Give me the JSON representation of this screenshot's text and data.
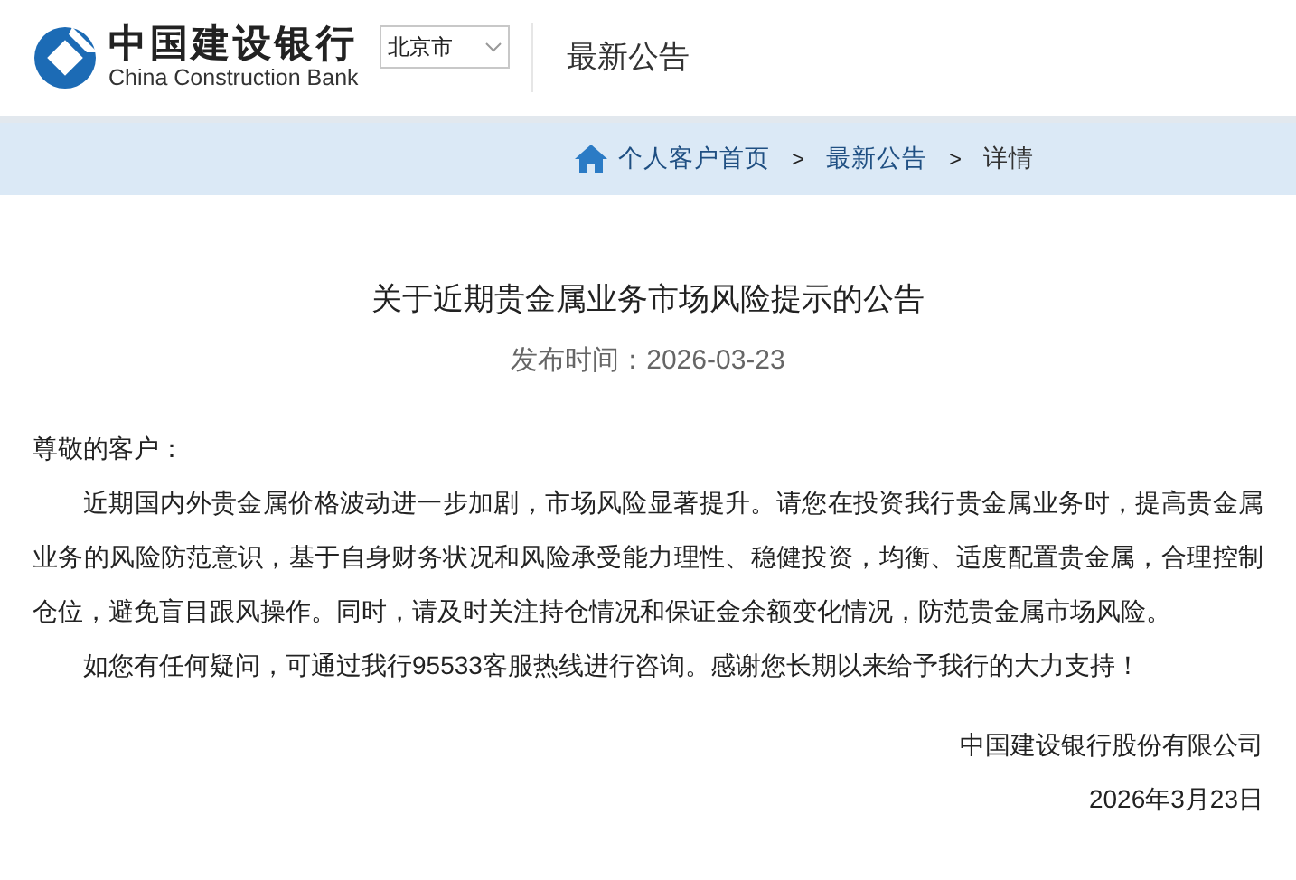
{
  "header": {
    "logo": {
      "name_cn": "中国建设银行",
      "name_en": "China Construction Bank"
    },
    "city_select": {
      "value": "北京市"
    },
    "section_title": "最新公告"
  },
  "breadcrumb": [
    {
      "label": "个人客户首页",
      "kind": "link"
    },
    {
      "label": ">",
      "kind": "separator"
    },
    {
      "label": "最新公告",
      "kind": "link"
    },
    {
      "label": ">",
      "kind": "separator"
    },
    {
      "label": "详情",
      "kind": "current"
    }
  ],
  "article": {
    "title": "关于近期贵金属业务市场风险提示的公告",
    "date": "发布时间：2026-03-23",
    "greeting": "尊敬的客户：",
    "paragraphs": [
      "近期国内外贵金属价格波动进一步加剧，市场风险显著提升。请您在投资我行贵金属业务时，提高贵金属业务的风险防范意识，基于自身财务状况和风险承受能力理性、稳健投资，均衡、适度配置贵金属，合理控制仓位，避免盲目跟风操作。同时，请及时关注持仓情况和保证金余额变化情况，防范贵金属市场风险。",
      "如您有任何疑问，可通过我行95533客服热线进行咨询。感谢您长期以来给予我行的大力支持！"
    ],
    "signature": "中国建设银行股份有限公司",
    "signature_date": "2026年3月23日"
  }
}
